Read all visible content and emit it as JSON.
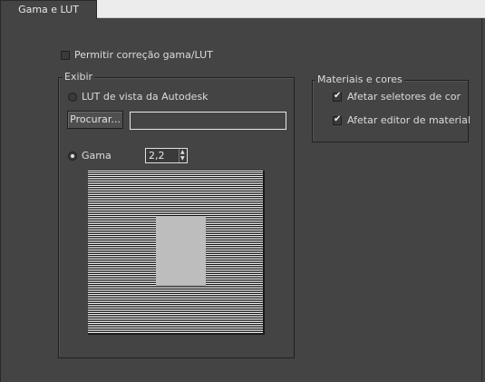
{
  "tabs": [
    {
      "label": "Gama e LUT"
    }
  ],
  "gamma_lut": {
    "enable_label": "Permitir correção gama/LUT",
    "enable_checked": false
  },
  "display_group": {
    "title": "Exibir",
    "lut_radio_label": "LUT de vista da Autodesk",
    "lut_selected": false,
    "browse_label": "Procurar...",
    "lut_path": "",
    "gamma_radio_label": "Gama",
    "gamma_selected": true,
    "gamma_value": "2,2"
  },
  "materials_group": {
    "title": "Materiais e cores",
    "affect_color_selectors_label": "Afetar seletores de cor",
    "affect_color_selectors_checked": true,
    "affect_material_editor_label": "Afetar editor de material",
    "affect_material_editor_checked": true
  }
}
